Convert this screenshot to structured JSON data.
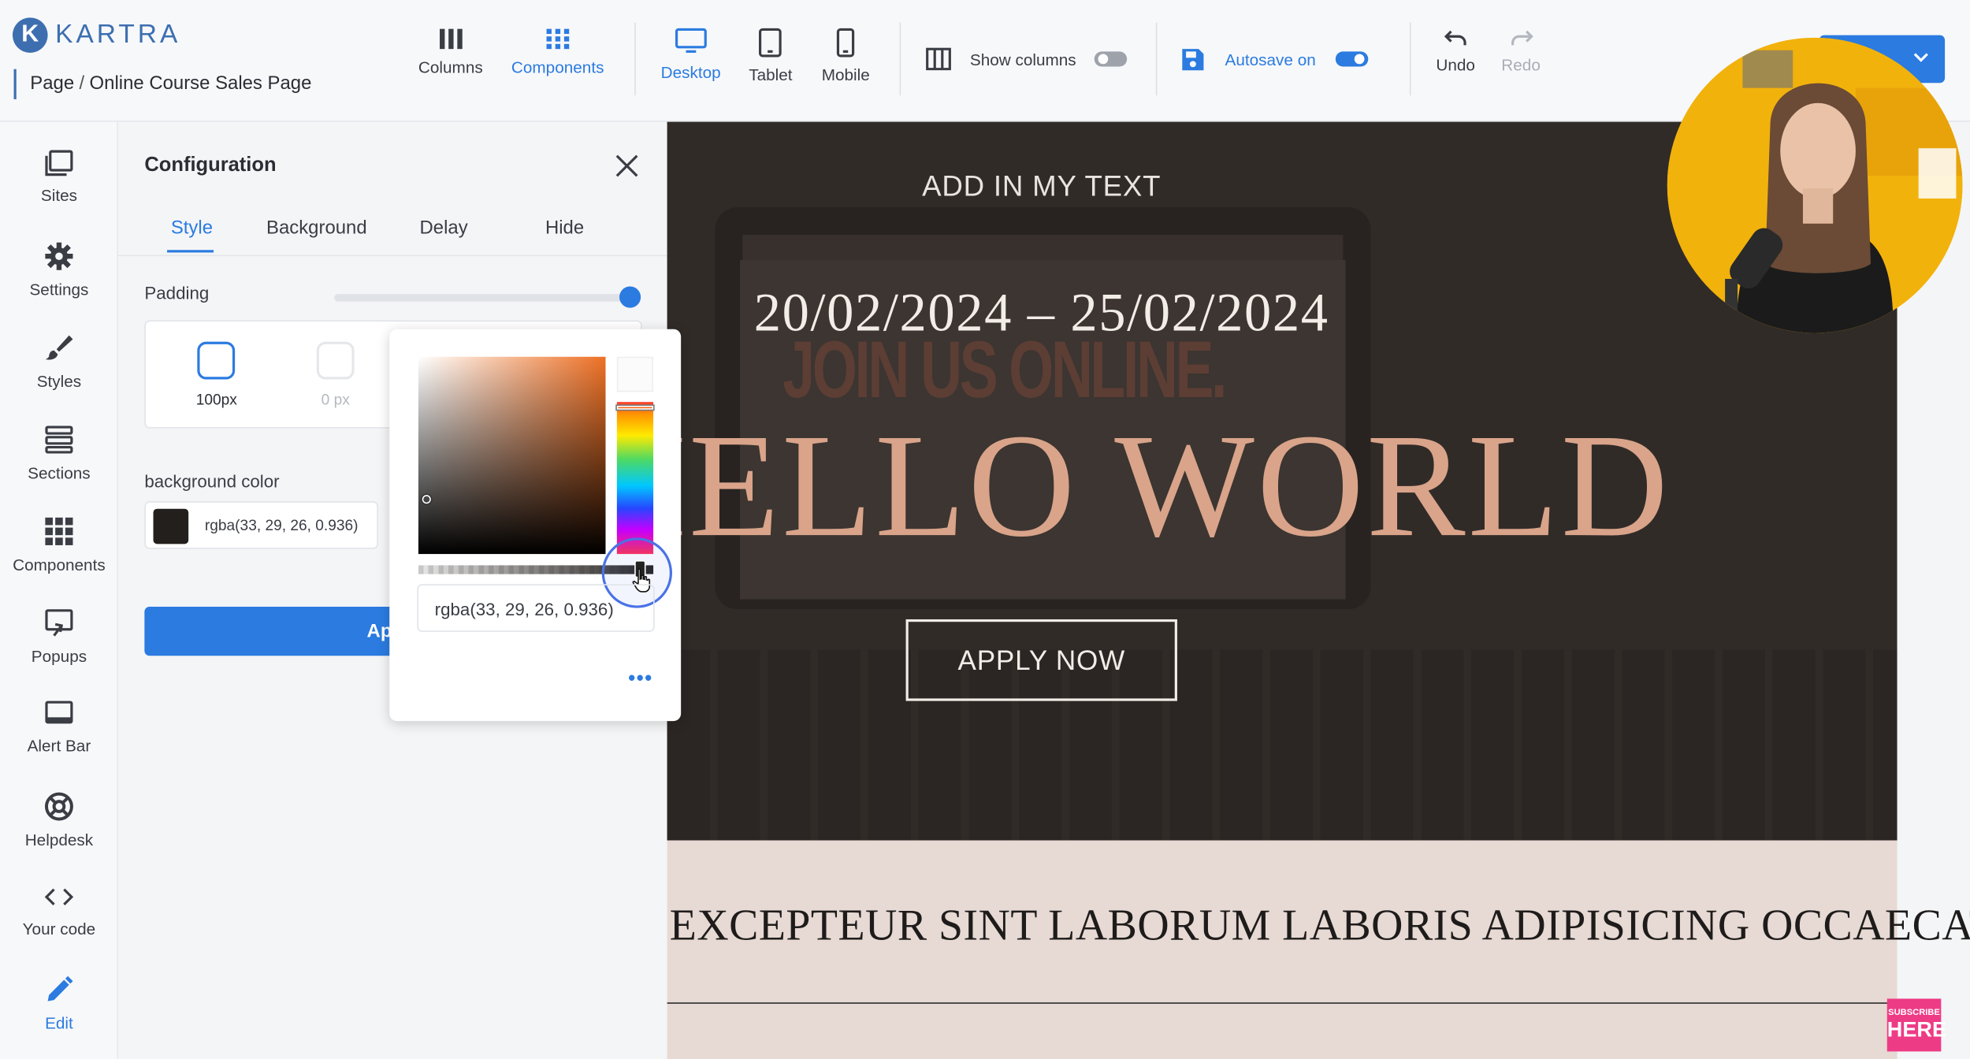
{
  "app": {
    "logo_text": "KARTRA"
  },
  "breadcrumb": {
    "root": "Page",
    "separator": "/",
    "current": "Online Course Sales Page"
  },
  "toolbar": {
    "columns": "Columns",
    "components": "Components",
    "desktop": "Desktop",
    "tablet": "Tablet",
    "mobile": "Mobile",
    "show_columns": "Show columns",
    "show_columns_on": false,
    "autosave": "Autosave on",
    "autosave_on": true,
    "undo": "Undo",
    "redo": "Redo"
  },
  "sidebar": {
    "items": [
      {
        "label": "Sites",
        "icon": "sites-icon"
      },
      {
        "label": "Settings",
        "icon": "gear-icon"
      },
      {
        "label": "Styles",
        "icon": "brush-icon"
      },
      {
        "label": "Sections",
        "icon": "sections-icon"
      },
      {
        "label": "Components",
        "icon": "grid-icon"
      },
      {
        "label": "Popups",
        "icon": "popup-icon"
      },
      {
        "label": "Alert Bar",
        "icon": "alert-bar-icon"
      },
      {
        "label": "Helpdesk",
        "icon": "helpdesk-icon"
      },
      {
        "label": "Your code",
        "icon": "code-icon"
      },
      {
        "label": "Edit",
        "icon": "pencil-icon"
      }
    ],
    "active": "Edit"
  },
  "config": {
    "title": "Configuration",
    "tabs": [
      "Style",
      "Background",
      "Delay",
      "Hide"
    ],
    "active_tab": "Style",
    "padding_label": "Padding",
    "padding_slider": 1.0,
    "padding_options": [
      "100px",
      "0 px"
    ],
    "background_label": "background color",
    "background_value": "rgba(33, 29, 26, 0.936)",
    "apply_button": "Ap"
  },
  "color_picker": {
    "value": "rgba(33, 29, 26, 0.936)",
    "alpha": 0.936,
    "more": "•••"
  },
  "canvas": {
    "eyebrow": "ADD IN MY TEXT",
    "dates": "20/02/2024 – 25/02/2024",
    "ghost_text": "JOIN US ONLINE.",
    "headline": "HELLO WORLD",
    "cta": "APPLY NOW",
    "band_text": "EXCEPTEUR SINT LABORUM LABORIS ADIPISICING OCCAECAT"
  },
  "subscribe": {
    "line1": "SUBSCRIBE",
    "line2": "HERE"
  },
  "colors": {
    "accent": "#2b7be0",
    "headline": "#d9a48a",
    "hero_bg": "#211d1a",
    "band_bg": "#e7d9d3"
  }
}
